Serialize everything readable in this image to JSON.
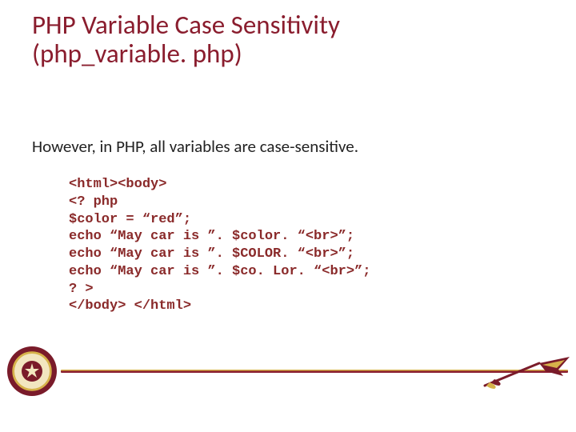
{
  "title_line1": "PHP Variable Case Sensitivity",
  "title_line2": "(php_variable. php)",
  "body": "However, in PHP, all variables are case-sensitive.",
  "code": "<html><body>\n<? php\n$color = “red”;\necho “May car is ”. $color. “<br>”;\necho “May car is ”. $COLOR. “<br>”;\necho “May car is ”. $co. Lor. “<br>”;\n? >\n</body> </html>"
}
